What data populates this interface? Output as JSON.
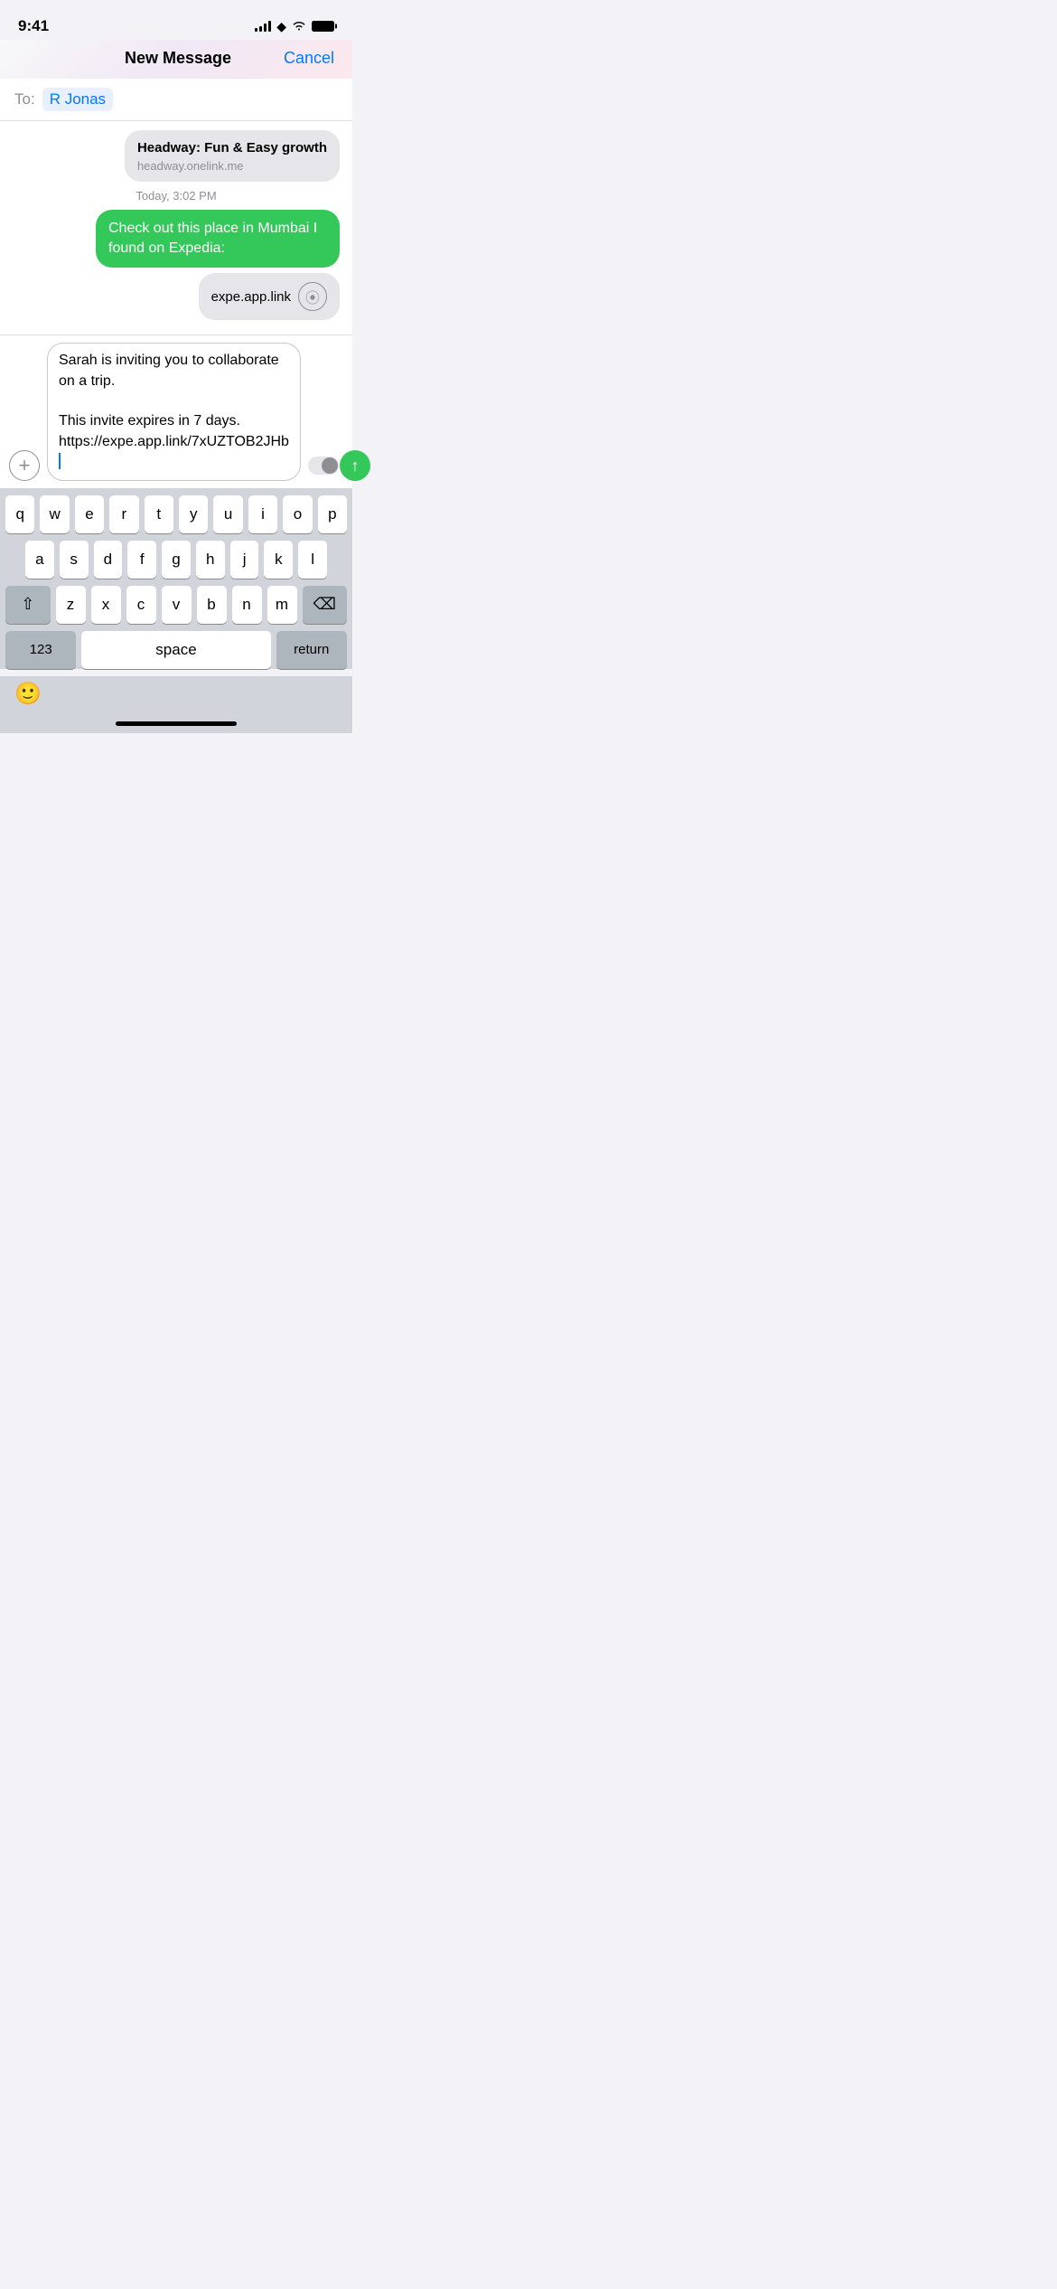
{
  "statusBar": {
    "time": "9:41",
    "signalBars": [
      4,
      6,
      8,
      10,
      12
    ],
    "batteryFull": true
  },
  "navBar": {
    "title": "New Message",
    "cancelLabel": "Cancel"
  },
  "toField": {
    "label": "To:",
    "recipient": "R Jonas"
  },
  "messages": [
    {
      "type": "received-link",
      "title": "Headway: Fun & Easy growth",
      "url": "headway.onelink.me"
    },
    {
      "type": "timestamp",
      "text": "Today, 3:02 PM"
    },
    {
      "type": "sent",
      "text": "Check out this place in Mumbai I found on Expedia:"
    },
    {
      "type": "link",
      "url": "expe.app.link"
    }
  ],
  "compose": {
    "plusLabel": "+",
    "inputText": "Sarah is inviting you to collaborate on a trip.\n\nThis invite expires in 7 days. https://expe.app.link/7xUZTOB2JHb",
    "sendLabel": "↑"
  },
  "keyboard": {
    "rows": [
      [
        "q",
        "w",
        "e",
        "r",
        "t",
        "y",
        "u",
        "i",
        "o",
        "p"
      ],
      [
        "a",
        "s",
        "d",
        "f",
        "g",
        "h",
        "j",
        "k",
        "l"
      ],
      [
        "z",
        "x",
        "c",
        "v",
        "b",
        "n",
        "m"
      ],
      [
        "123",
        "space",
        "return"
      ]
    ],
    "emojiLabel": "🙂",
    "homeIndicator": ""
  }
}
